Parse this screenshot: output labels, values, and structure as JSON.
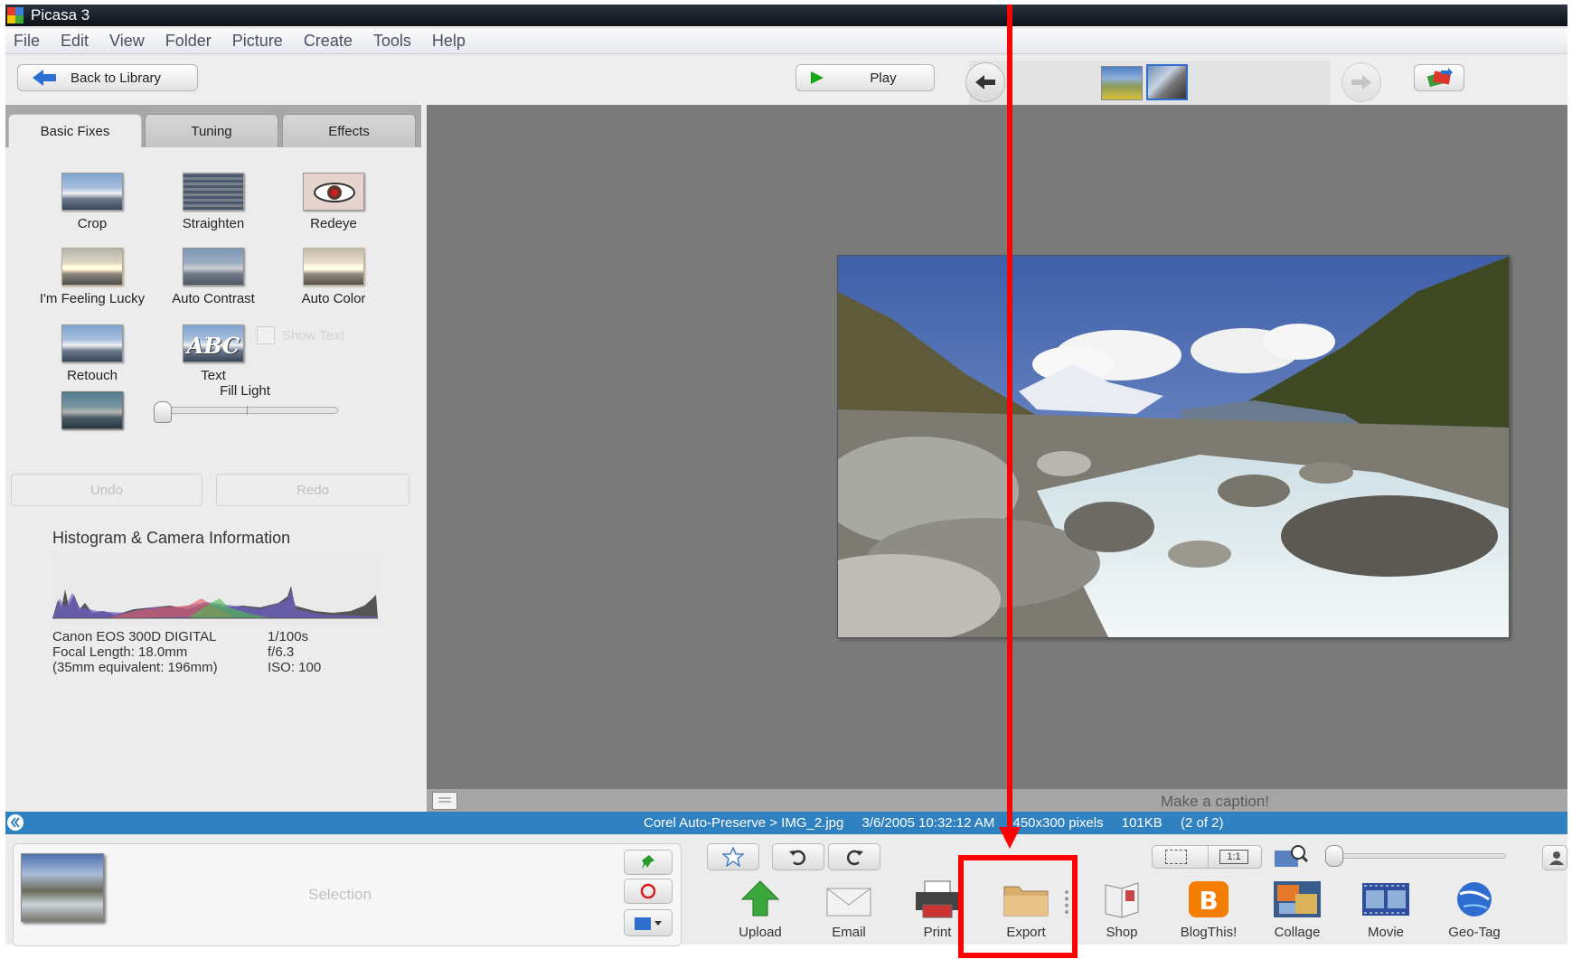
{
  "window": {
    "title": "Picasa 3"
  },
  "menu": [
    "File",
    "Edit",
    "View",
    "Folder",
    "Picture",
    "Create",
    "Tools",
    "Help"
  ],
  "toolbar": {
    "back_label": "Back to Library",
    "play_label": "Play"
  },
  "tabs": [
    "Basic Fixes",
    "Tuning",
    "Effects"
  ],
  "tools": [
    "Crop",
    "Straighten",
    "Redeye",
    "I'm Feeling Lucky",
    "Auto Contrast",
    "Auto Color",
    "Retouch",
    "Text"
  ],
  "show_text_label": "Show Text",
  "fill_light": {
    "label": "Fill Light",
    "level": 0.0
  },
  "undo_label": "Undo",
  "redo_label": "Redo",
  "histogram": {
    "title": "Histogram & Camera Information",
    "camera": "Canon EOS 300D DIGITAL",
    "focal": "Focal Length: 18.0mm",
    "equiv": "(35mm equivalent: 196mm)",
    "shutter": "1/100s",
    "aperture": "f/6.3",
    "iso": "ISO: 100"
  },
  "caption_placeholder": "Make a caption!",
  "status": {
    "path": "Corel Auto-Preserve > IMG_2.jpg",
    "date": "3/6/2005 10:32:12 AM",
    "dims": "450x300 pixels",
    "size": "101KB",
    "count": "(2 of 2)"
  },
  "selection_label": "Selection",
  "one_to_one": "1:1",
  "actions": [
    "Upload",
    "Email",
    "Print",
    "Export",
    "Shop",
    "BlogThis!",
    "Collage",
    "Movie",
    "Geo-Tag"
  ],
  "colors": {
    "annotation": "#ff0000",
    "status_bar": "#2f81c0",
    "viewer_bg": "#7b7b7b"
  }
}
